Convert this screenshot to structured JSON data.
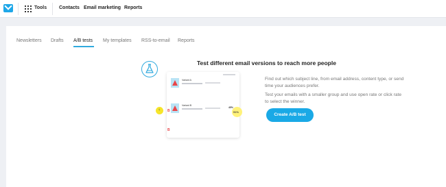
{
  "topbar": {
    "tools_label": "Tools",
    "nav": [
      "Contacts",
      "Email marketing",
      "Reports"
    ]
  },
  "tabs": [
    {
      "label": "Newsletters",
      "active": false
    },
    {
      "label": "Drafts",
      "active": false
    },
    {
      "label": "A/B tests",
      "active": true
    },
    {
      "label": "My templates",
      "active": false
    },
    {
      "label": "RSS-to-email",
      "active": false
    },
    {
      "label": "Reports",
      "active": false
    }
  ],
  "main": {
    "headline": "Test different email versions to reach more people",
    "paragraph_1": "Find out which subject line, from email address, content type, or send time your audiences prefer.",
    "paragraph_2": "Test your emails with a smaller group and use open rate or click rate to select the winner.",
    "cta_label": "Create A/B test"
  },
  "illustration": {
    "variant_a": "Variant A",
    "variant_b": "Variant B",
    "variant_a_pct": "51%",
    "variant_b_pct": "45%",
    "letter": "B"
  },
  "colors": {
    "accent": "#1aa9e6",
    "trophy": "#f6e52a",
    "highlight": "#fff27a"
  }
}
